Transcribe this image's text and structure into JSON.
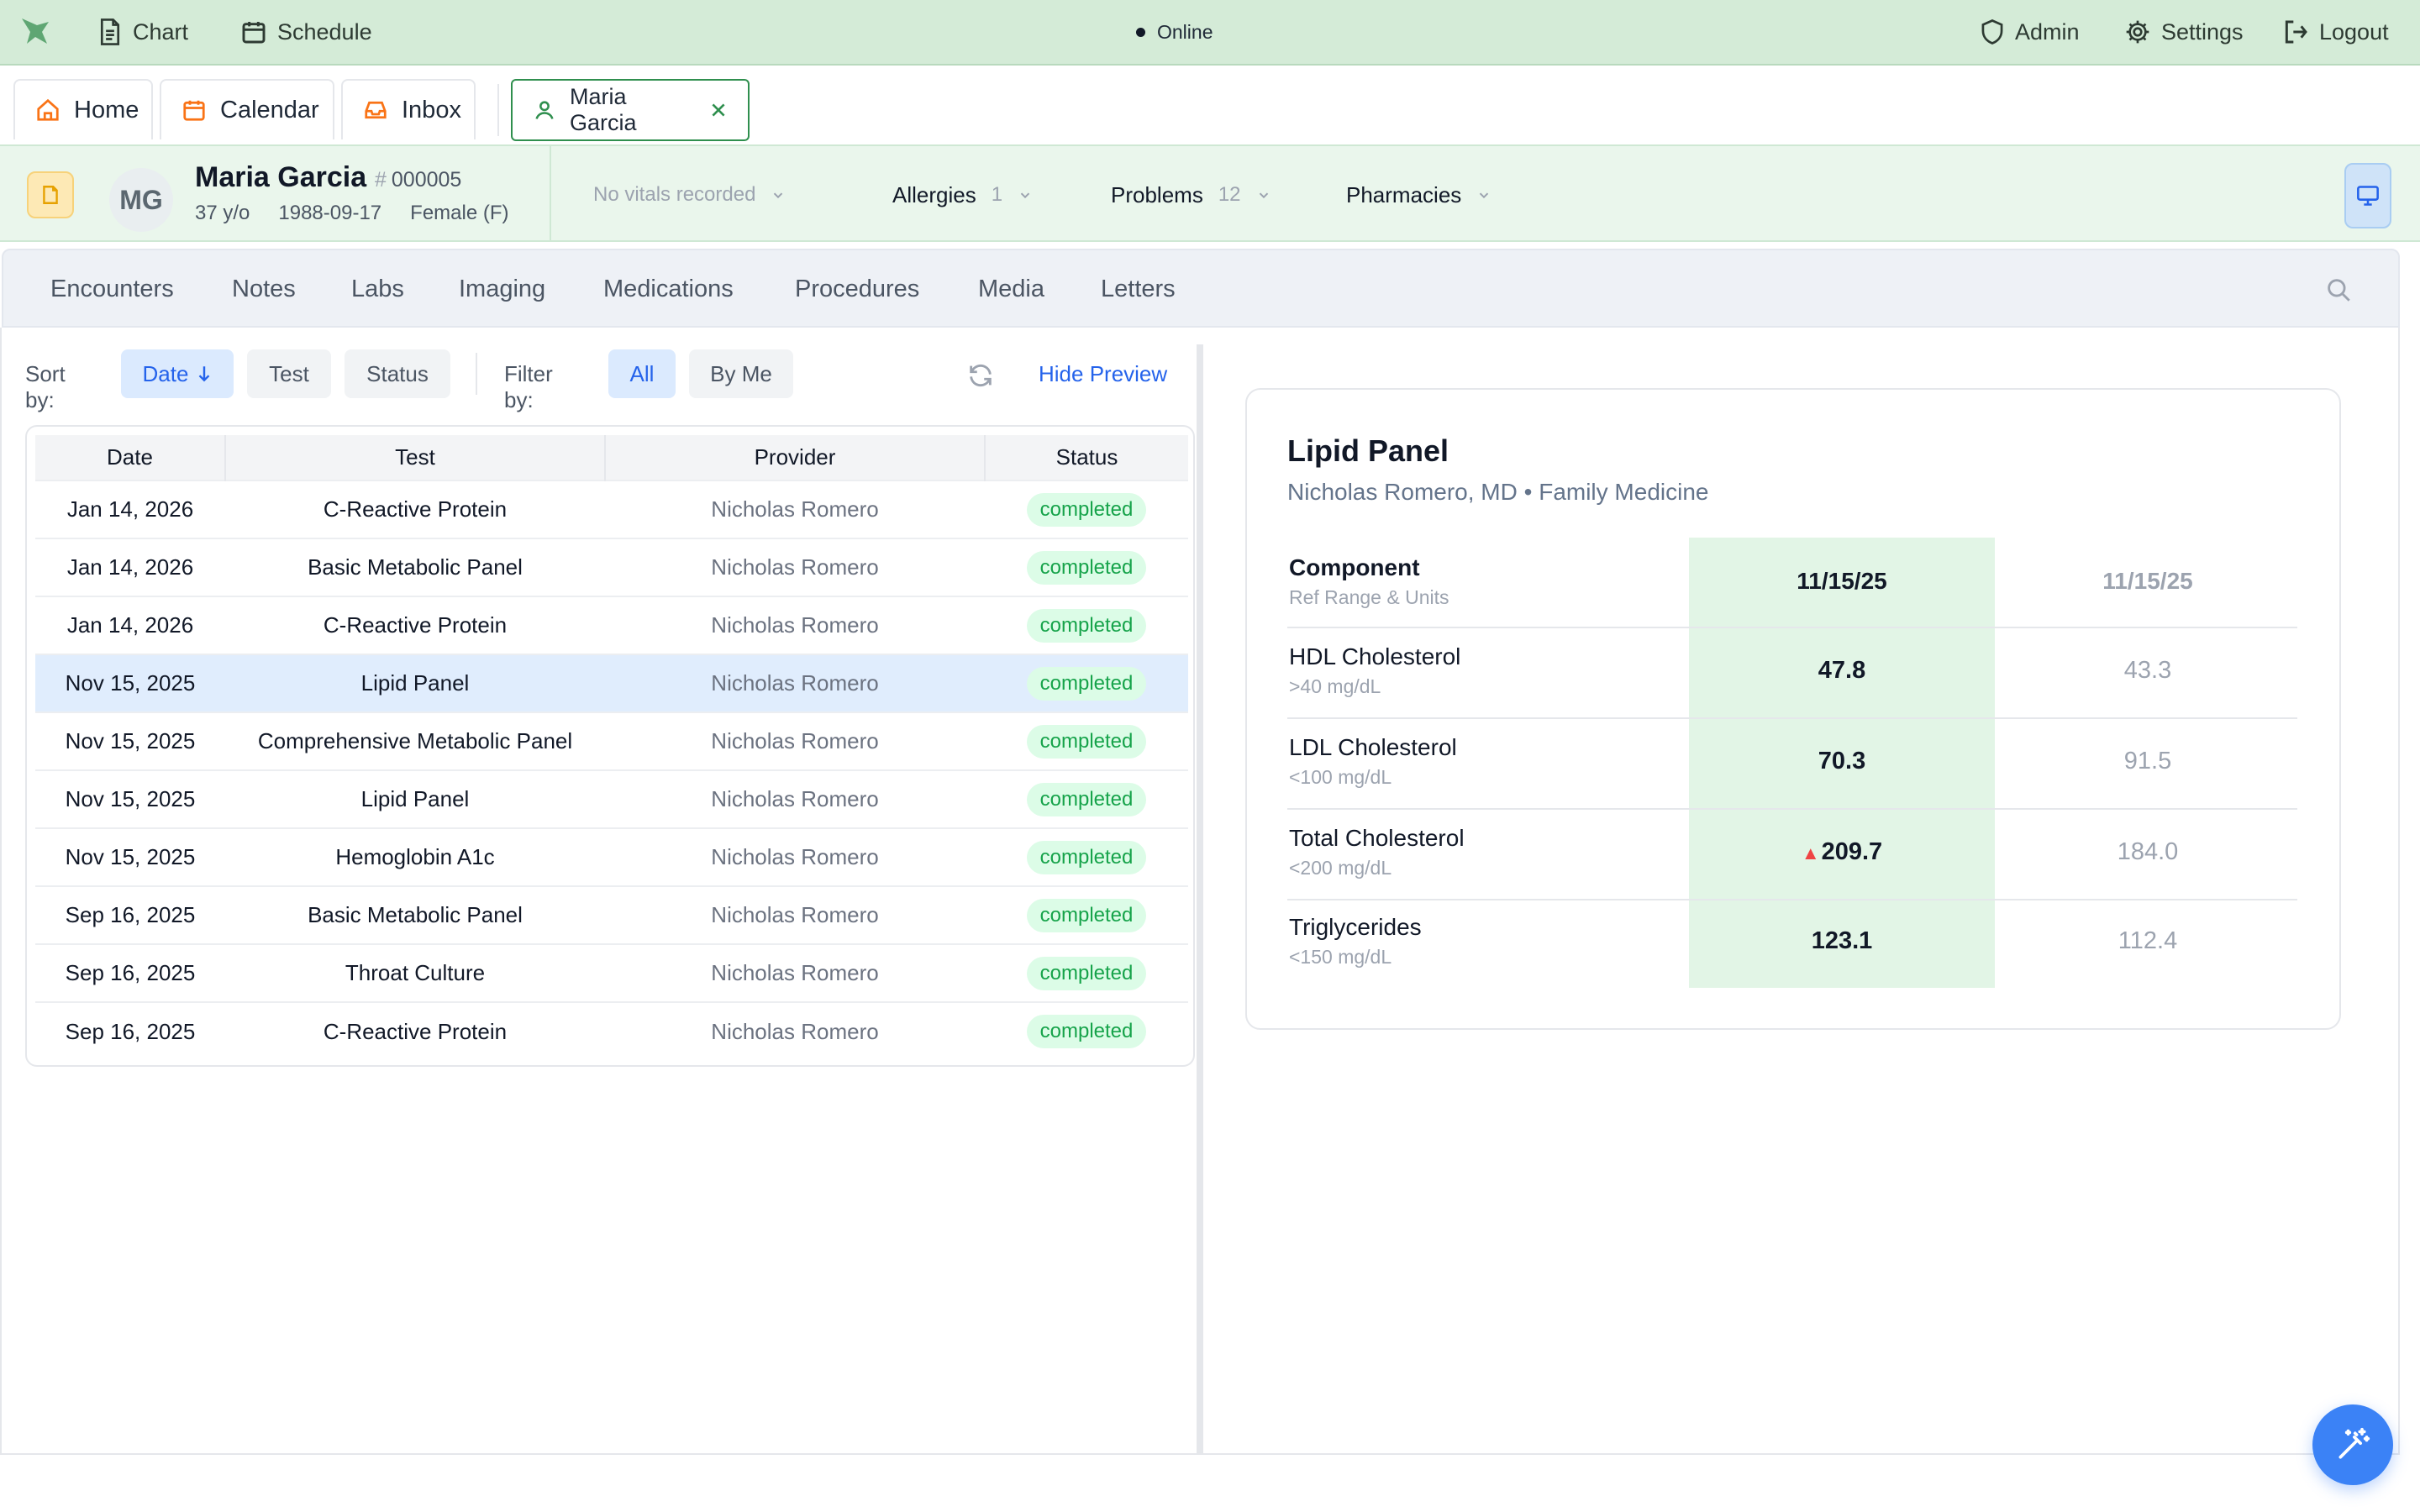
{
  "topbar": {
    "nav": [
      {
        "label": "Chart",
        "icon": "file-text-icon"
      },
      {
        "label": "Schedule",
        "icon": "calendar-icon"
      }
    ],
    "status": "Online",
    "right": [
      {
        "label": "Admin",
        "icon": "shield-icon"
      },
      {
        "label": "Settings",
        "icon": "gear-icon"
      },
      {
        "label": "Logout",
        "icon": "logout-icon"
      }
    ]
  },
  "tabs": [
    {
      "label": "Home",
      "icon": "home-icon"
    },
    {
      "label": "Calendar",
      "icon": "calendar-icon"
    },
    {
      "label": "Inbox",
      "icon": "inbox-icon"
    },
    {
      "label": "Maria Garcia",
      "icon": "user-icon",
      "active": true
    }
  ],
  "patient": {
    "initials": "MG",
    "name": "Maria Garcia",
    "id": "000005",
    "age": "37 y/o",
    "dob": "1988-09-17",
    "sex": "Female (F)",
    "vitals": "No vitals recorded",
    "allergies": {
      "label": "Allergies",
      "count": "1"
    },
    "problems": {
      "label": "Problems",
      "count": "12"
    },
    "pharmacies": {
      "label": "Pharmacies"
    }
  },
  "sections": [
    "Encounters",
    "Notes",
    "Labs",
    "Imaging",
    "Medications",
    "Procedures",
    "Media",
    "Letters"
  ],
  "toolbar": {
    "sort_label": "Sort by:",
    "sort_options": [
      "Date",
      "Test",
      "Status"
    ],
    "sort_active": "Date",
    "filter_label": "Filter by:",
    "filter_options": [
      "All",
      "By Me"
    ],
    "filter_active": "All",
    "hide_preview": "Hide Preview"
  },
  "results": {
    "columns": [
      "Date",
      "Test",
      "Provider",
      "Status"
    ],
    "rows": [
      {
        "date": "Jan 14, 2026",
        "test": "C-Reactive Protein",
        "provider": "Nicholas Romero",
        "status": "completed"
      },
      {
        "date": "Jan 14, 2026",
        "test": "Basic Metabolic Panel",
        "provider": "Nicholas Romero",
        "status": "completed"
      },
      {
        "date": "Jan 14, 2026",
        "test": "C-Reactive Protein",
        "provider": "Nicholas Romero",
        "status": "completed"
      },
      {
        "date": "Nov 15, 2025",
        "test": "Lipid Panel",
        "provider": "Nicholas Romero",
        "status": "completed",
        "selected": true
      },
      {
        "date": "Nov 15, 2025",
        "test": "Comprehensive Metabolic Panel",
        "provider": "Nicholas Romero",
        "status": "completed"
      },
      {
        "date": "Nov 15, 2025",
        "test": "Lipid Panel",
        "provider": "Nicholas Romero",
        "status": "completed"
      },
      {
        "date": "Nov 15, 2025",
        "test": "Hemoglobin A1c",
        "provider": "Nicholas Romero",
        "status": "completed"
      },
      {
        "date": "Sep 16, 2025",
        "test": "Basic Metabolic Panel",
        "provider": "Nicholas Romero",
        "status": "completed"
      },
      {
        "date": "Sep 16, 2025",
        "test": "Throat Culture",
        "provider": "Nicholas Romero",
        "status": "completed"
      },
      {
        "date": "Sep 16, 2025",
        "test": "C-Reactive Protein",
        "provider": "Nicholas Romero",
        "status": "completed"
      }
    ]
  },
  "preview": {
    "title": "Lipid Panel",
    "subtitle": "Nicholas Romero, MD • Family Medicine",
    "header": {
      "component": "Component",
      "ref": "Ref Range & Units",
      "col1": "11/15/25",
      "col2": "11/15/25"
    },
    "components": [
      {
        "name": "HDL Cholesterol",
        "ref": ">40 mg/dL",
        "current": "47.8",
        "previous": "43.3",
        "flag": ""
      },
      {
        "name": "LDL Cholesterol",
        "ref": "<100 mg/dL",
        "current": "70.3",
        "previous": "91.5",
        "flag": ""
      },
      {
        "name": "Total Cholesterol",
        "ref": "<200 mg/dL",
        "current": "209.7",
        "previous": "184.0",
        "flag": "▲"
      },
      {
        "name": "Triglycerides",
        "ref": "<150 mg/dL",
        "current": "123.1",
        "previous": "112.4",
        "flag": ""
      }
    ]
  },
  "colors": {
    "accent_green": "#2f8f4e",
    "accent_blue": "#2563eb",
    "abnormal": "#ef4444"
  }
}
